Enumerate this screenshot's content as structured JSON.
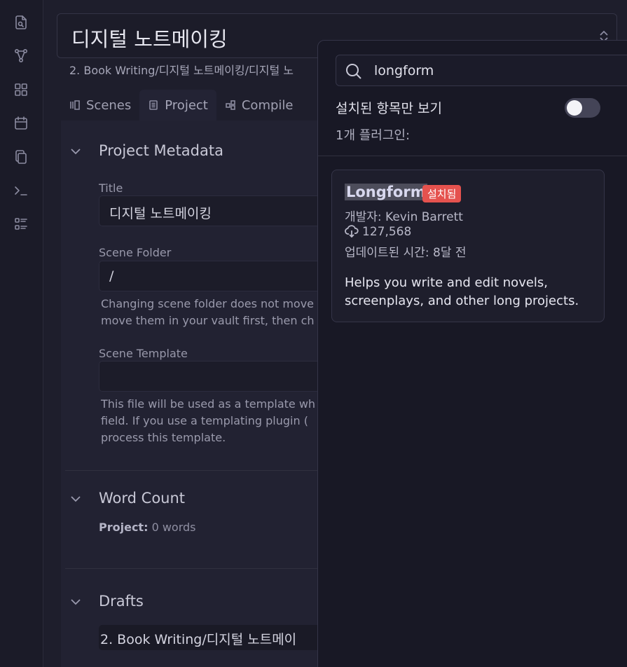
{
  "ribbon": {
    "icons": [
      "search-file-icon",
      "graph-icon",
      "grid-icon",
      "calendar-icon",
      "copy-icon",
      "terminal-icon",
      "list-icon"
    ]
  },
  "header": {
    "title": "디지털 노트메이킹",
    "path": "2. Book Writing/디지털 노트메이킹/디지털 노"
  },
  "tabs": [
    {
      "label": "Scenes",
      "icon": "scenes-icon"
    },
    {
      "label": "Project",
      "icon": "document-icon"
    },
    {
      "label": "Compile",
      "icon": "compile-icon"
    }
  ],
  "metadata": {
    "section_title": "Project Metadata",
    "title_label": "Title",
    "title_value": "디지털 노트메이킹",
    "scene_folder_label": "Scene Folder",
    "scene_folder_value": "/",
    "scene_folder_help_1": "Changing scene folder does not move",
    "scene_folder_help_2": "move them in your vault first, then ch",
    "scene_template_label": "Scene Template",
    "scene_template_value": "",
    "scene_template_help_1": "This file will be used as a template wh",
    "scene_template_help_2": "field. If you use a templating plugin (",
    "scene_template_help_3": "process this template."
  },
  "word_count": {
    "section_title": "Word Count",
    "project_label": "Project:",
    "project_value": "0 words"
  },
  "drafts": {
    "section_title": "Drafts",
    "item": "2. Book Writing/디지털 노트메이"
  },
  "popup": {
    "search_value": "longform",
    "toggle_label": "설치된 항목만 보기",
    "toggle_on": false,
    "count_text": "1개 플러그인:",
    "plugin": {
      "name": "Longform",
      "badge": "설치됨",
      "author": "개발자: Kevin Barrett",
      "downloads": "127,568",
      "updated": "업데이트된 시간: 8달 전",
      "description": "Helps you write and edit novels, screenplays, and other long projects."
    },
    "colors": {
      "badge": "#e5524e",
      "background": "#181825"
    }
  }
}
